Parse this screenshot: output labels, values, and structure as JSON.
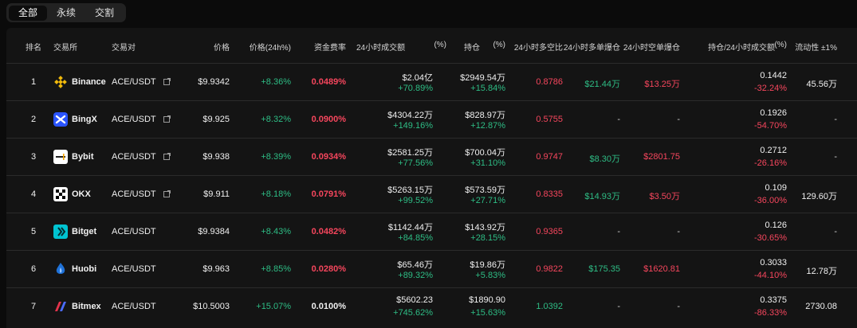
{
  "tabs": [
    "全部",
    "永续",
    "交割"
  ],
  "headers": {
    "rank": "排名",
    "exchange": "交易所",
    "pair": "交易对",
    "price": "价格",
    "change": "价格(24h%)",
    "funding": "资金费率",
    "volume": "24小时成交额",
    "volume_pct": "(%)",
    "oi": "持仓",
    "oi_pct": "(%)",
    "ls": "24小时多空比",
    "long_liq": "24小时多单爆仓",
    "short_liq": "24小时空单爆仓",
    "oi_vol": "持仓/24小时成交额",
    "oi_vol_pct": "(%)",
    "liquidity": "流动性 ±1%"
  },
  "rows": [
    {
      "rank": "1",
      "exchange": "Binance",
      "logo": "binance-logo-icon",
      "pair": "ACE/USDT",
      "link": true,
      "price": "$9.9342",
      "change": "+8.36%",
      "funding": "0.0489%",
      "funding_color": "red",
      "volume": "$2.04亿",
      "volume_pct": "+70.89%",
      "oi": "$2949.54万",
      "oi_pct": "+15.84%",
      "ls": "0.8786",
      "ls_color": "red",
      "long_liq": "$21.44万",
      "short_liq": "$13.25万",
      "oi_vol": "0.1442",
      "oi_vol_pct": "-32.24%",
      "liquidity": "45.56万"
    },
    {
      "rank": "2",
      "exchange": "BingX",
      "logo": "bingx-logo-icon",
      "pair": "ACE/USDT",
      "link": true,
      "price": "$9.925",
      "change": "+8.32%",
      "funding": "0.0900%",
      "funding_color": "red",
      "volume": "$4304.22万",
      "volume_pct": "+149.16%",
      "oi": "$828.97万",
      "oi_pct": "+12.87%",
      "ls": "0.5755",
      "ls_color": "red",
      "long_liq": "-",
      "short_liq": "-",
      "oi_vol": "0.1926",
      "oi_vol_pct": "-54.70%",
      "liquidity": "-"
    },
    {
      "rank": "3",
      "exchange": "Bybit",
      "logo": "bybit-logo-icon",
      "pair": "ACE/USDT",
      "link": true,
      "price": "$9.938",
      "change": "+8.39%",
      "funding": "0.0934%",
      "funding_color": "red",
      "volume": "$2581.25万",
      "volume_pct": "+77.56%",
      "oi": "$700.04万",
      "oi_pct": "+31.10%",
      "ls": "0.9747",
      "ls_color": "red",
      "long_liq": "$8.30万",
      "short_liq": "$2801.75",
      "oi_vol": "0.2712",
      "oi_vol_pct": "-26.16%",
      "liquidity": "-"
    },
    {
      "rank": "4",
      "exchange": "OKX",
      "logo": "okx-logo-icon",
      "pair": "ACE/USDT",
      "link": true,
      "price": "$9.911",
      "change": "+8.18%",
      "funding": "0.0791%",
      "funding_color": "red",
      "volume": "$5263.15万",
      "volume_pct": "+99.52%",
      "oi": "$573.59万",
      "oi_pct": "+27.71%",
      "ls": "0.8335",
      "ls_color": "red",
      "long_liq": "$14.93万",
      "short_liq": "$3.50万",
      "oi_vol": "0.109",
      "oi_vol_pct": "-36.00%",
      "liquidity": "129.60万"
    },
    {
      "rank": "5",
      "exchange": "Bitget",
      "logo": "bitget-logo-icon",
      "pair": "ACE/USDT",
      "link": false,
      "price": "$9.9384",
      "change": "+8.43%",
      "funding": "0.0482%",
      "funding_color": "red",
      "volume": "$1142.44万",
      "volume_pct": "+84.85%",
      "oi": "$143.92万",
      "oi_pct": "+28.15%",
      "ls": "0.9365",
      "ls_color": "red",
      "long_liq": "-",
      "short_liq": "-",
      "oi_vol": "0.126",
      "oi_vol_pct": "-30.65%",
      "liquidity": "-"
    },
    {
      "rank": "6",
      "exchange": "Huobi",
      "logo": "huobi-logo-icon",
      "pair": "ACE/USDT",
      "link": false,
      "price": "$9.963",
      "change": "+8.85%",
      "funding": "0.0280%",
      "funding_color": "red",
      "volume": "$65.46万",
      "volume_pct": "+89.32%",
      "oi": "$19.86万",
      "oi_pct": "+5.83%",
      "ls": "0.9822",
      "ls_color": "red",
      "long_liq": "$175.35",
      "short_liq": "$1620.81",
      "oi_vol": "0.3033",
      "oi_vol_pct": "-44.10%",
      "liquidity": "12.78万"
    },
    {
      "rank": "7",
      "exchange": "Bitmex",
      "logo": "bitmex-logo-icon",
      "pair": "ACE/USDT",
      "link": false,
      "price": "$10.5003",
      "change": "+15.07%",
      "funding": "0.0100%",
      "funding_color": "white",
      "volume": "$5602.23",
      "volume_pct": "+745.62%",
      "oi": "$1890.90",
      "oi_pct": "+15.63%",
      "ls": "1.0392",
      "ls_color": "green",
      "long_liq": "-",
      "short_liq": "-",
      "oi_vol": "0.3375",
      "oi_vol_pct": "-86.33%",
      "liquidity": "2730.08"
    }
  ],
  "colors": {
    "green": "#2ebd85",
    "red": "#f6465d",
    "white": "#f0f0f0",
    "binance": "#f0b90b",
    "bingx": "#2a54ff",
    "bitget": "#00c3d1",
    "huobi": "#1f72d8",
    "bitmex": "#e2334b"
  }
}
